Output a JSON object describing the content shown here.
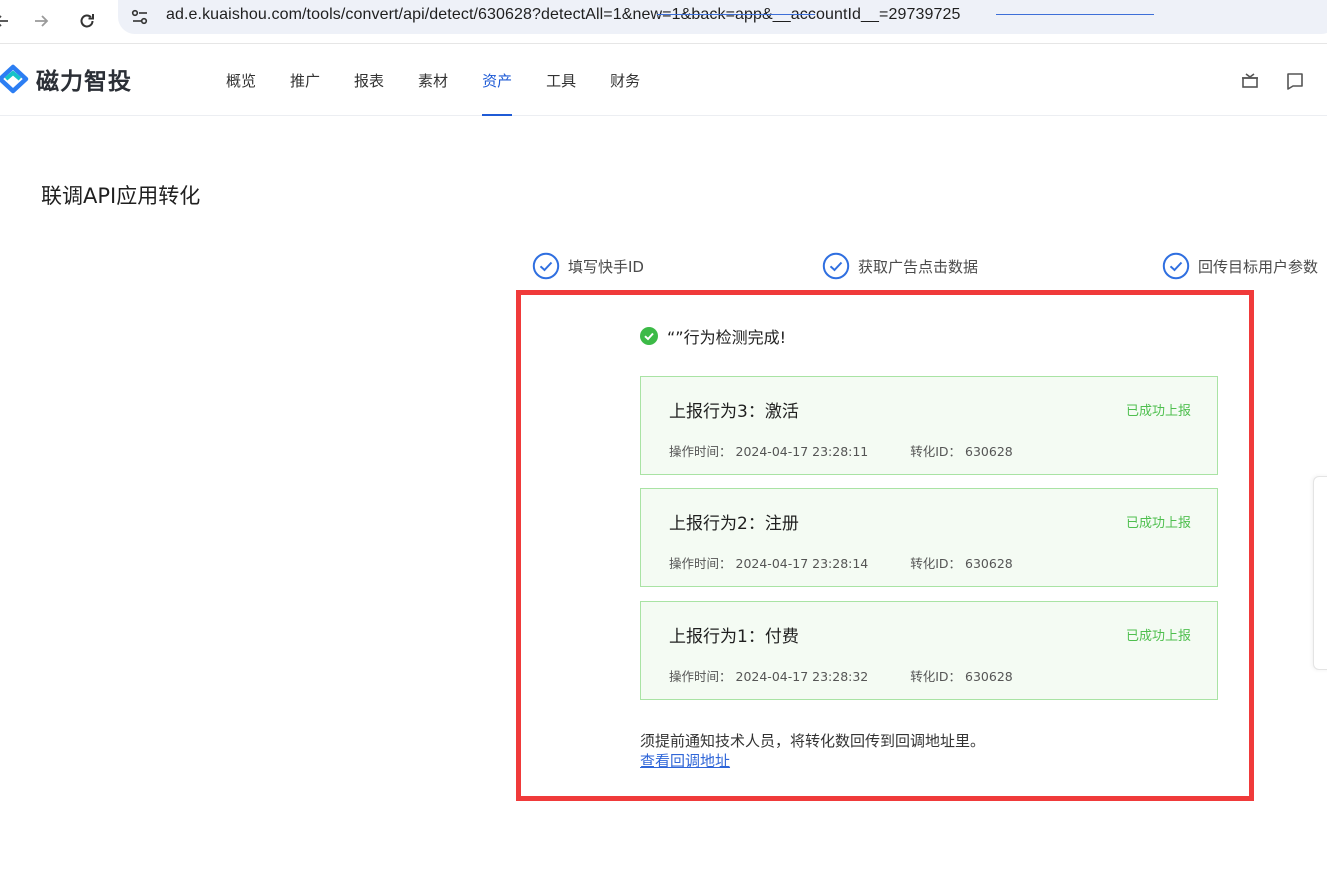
{
  "browser": {
    "url": "ad.e.kuaishou.com/tools/convert/api/detect/630628?detectAll=1&new=1&back=app&__accountId__=29739725"
  },
  "app": {
    "logo_text": "磁力智投",
    "menu": [
      {
        "label": "概览",
        "active": false
      },
      {
        "label": "推广",
        "active": false
      },
      {
        "label": "报表",
        "active": false
      },
      {
        "label": "素材",
        "active": false
      },
      {
        "label": "资产",
        "active": true
      },
      {
        "label": "工具",
        "active": false
      },
      {
        "label": "财务",
        "active": false
      }
    ],
    "accent_color": "#1f5bd6"
  },
  "page": {
    "title": "联调API应用转化"
  },
  "steps": [
    {
      "label": "填写快手ID"
    },
    {
      "label": "获取广告点击数据"
    },
    {
      "label": "回传目标用户参数"
    }
  ],
  "result": {
    "headline": "“”行为检测完成!",
    "cards": [
      {
        "title": "上报行为3：激活",
        "status": "已成功上报",
        "time_label": "操作时间：",
        "time": "2024-04-17 23:28:11",
        "id_label": "转化ID：",
        "id": "630628"
      },
      {
        "title": "上报行为2：注册",
        "status": "已成功上报",
        "time_label": "操作时间：",
        "time": "2024-04-17 23:28:14",
        "id_label": "转化ID：",
        "id": "630628"
      },
      {
        "title": "上报行为1：付费",
        "status": "已成功上报",
        "time_label": "操作时间：",
        "time": "2024-04-17 23:28:32",
        "id_label": "转化ID：",
        "id": "630628"
      }
    ],
    "notice": "须提前通知技术人员，将转化数回传到回调地址里。",
    "link": "查看回调地址",
    "success_color": "#4fbf4f"
  }
}
